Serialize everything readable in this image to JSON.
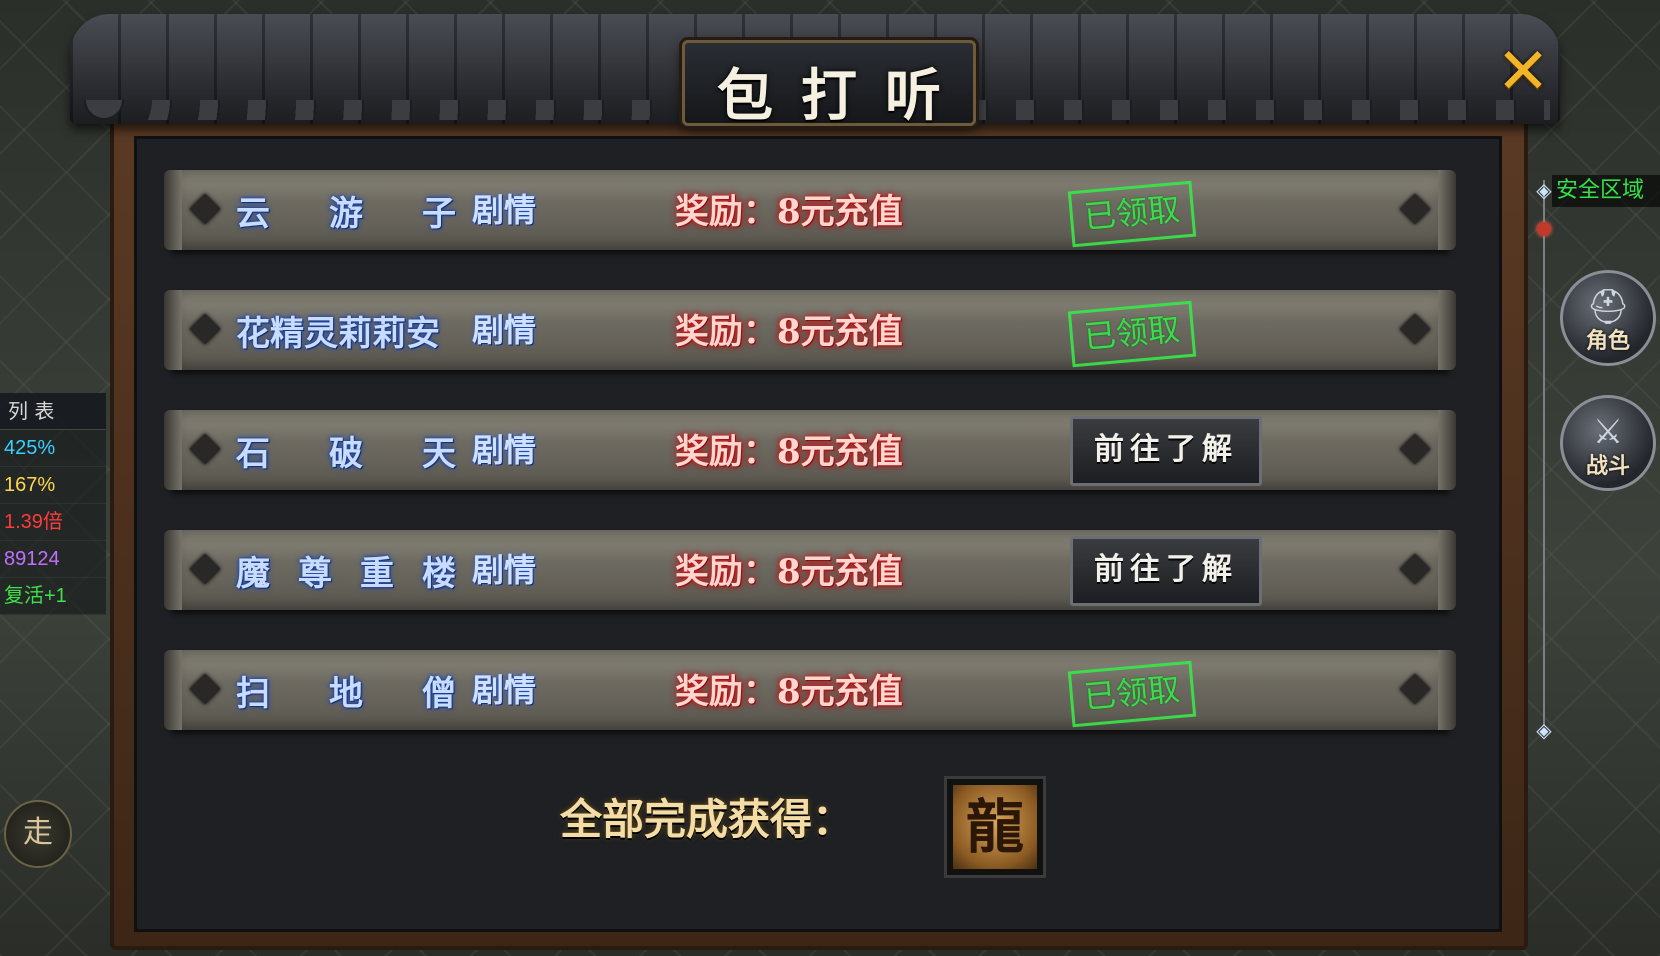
{
  "panel": {
    "title": "包打听",
    "close_glyph": "✕"
  },
  "stories": [
    {
      "name_chars": [
        "云",
        "游",
        "子"
      ],
      "suffix": "剧情",
      "reward": "奖励：8元充值",
      "status": "claimed",
      "status_text": "已领取"
    },
    {
      "name_chars": [
        "花精灵莉莉安"
      ],
      "suffix": "剧情",
      "reward": "奖励：8元充值",
      "status": "claimed",
      "status_text": "已领取"
    },
    {
      "name_chars": [
        "石",
        "破",
        "天"
      ],
      "suffix": "剧情",
      "reward": "奖励：8元充值",
      "status": "pending",
      "status_text": "前往了解"
    },
    {
      "name_chars": [
        "魔",
        "尊",
        "重",
        "楼"
      ],
      "suffix": "剧情",
      "reward": "奖励：8元充值",
      "status": "pending",
      "status_text": "前往了解"
    },
    {
      "name_chars": [
        "扫",
        "地",
        "僧"
      ],
      "suffix": "剧情",
      "reward": "奖励：8元充值",
      "status": "claimed",
      "status_text": "已领取"
    }
  ],
  "footer": {
    "complete_label": "全部完成获得：",
    "reward_icon": "dragon-icon",
    "reward_glyph": "龍"
  },
  "left_hud": {
    "header": "列 表",
    "stats": [
      {
        "text": "425%",
        "color": "#39d0ff"
      },
      {
        "text": "167%",
        "color": "#ffd84a"
      },
      {
        "text": "1.39倍",
        "color": "#ff3b3b"
      },
      {
        "text": "89124",
        "color": "#c070ff"
      },
      {
        "text": "复活+1",
        "color": "#3fe04a"
      }
    ],
    "walk_label": "走"
  },
  "right_hud": {
    "safe_zone": "安全区域",
    "role_label": "角色",
    "fight_label": "战斗"
  },
  "colors": {
    "accent_gold": "#f2b52a",
    "story_blue": "#c8dcff",
    "reward_red": "#d01f1f",
    "stamp_green": "#38e84a"
  }
}
